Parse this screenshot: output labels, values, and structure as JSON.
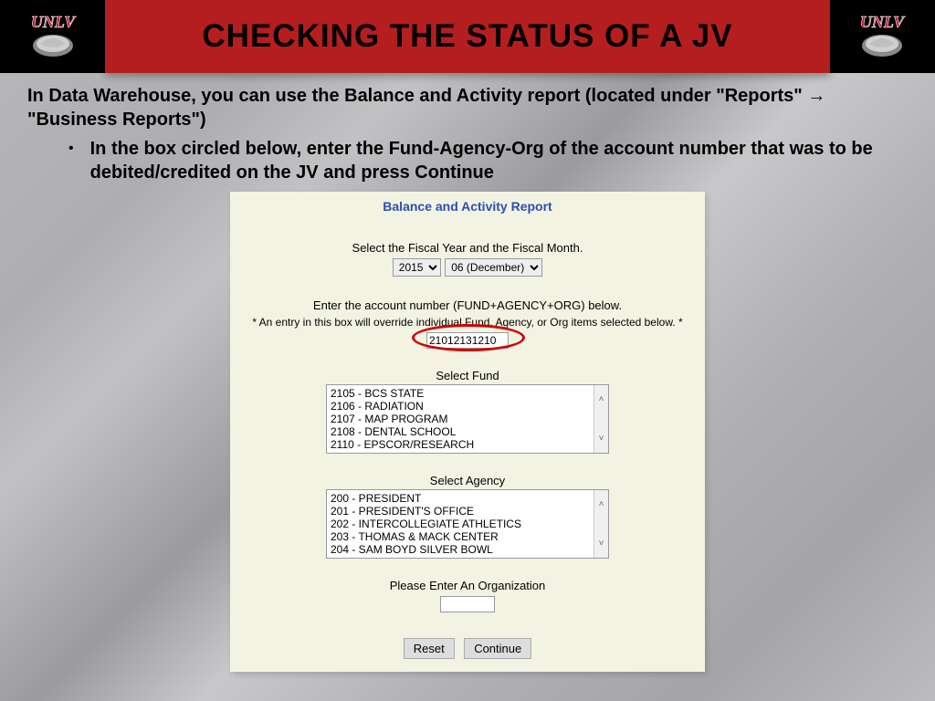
{
  "header": {
    "title": "CHECKING THE STATUS OF A JV"
  },
  "intro": {
    "line1_pre": "In Data Warehouse, you can use the Balance and Activity report (located under \"Reports\" ",
    "arrow": "→",
    "line1_post": " \"Business Reports\")"
  },
  "bullet": {
    "text": "In the box circled below, enter the Fund-Agency-Org of the account number that was to be debited/credited on the JV and press Continue"
  },
  "report": {
    "title": "Balance and Activity Report",
    "select_fy_line": "Select the Fiscal Year and the Fiscal Month.",
    "year_selected": "2015",
    "month_selected": "06  (December)",
    "acct_line": "Enter the account number (FUND+AGENCY+ORG) below.",
    "acct_hint": "* An entry in this box will override individual Fund, Agency, or Org items selected below. *",
    "acct_value": "21012131210",
    "fund_label": "Select Fund",
    "fund_items": [
      "2105 - BCS STATE",
      "2106 - RADIATION",
      "2107 - MAP PROGRAM",
      "2108 - DENTAL SCHOOL",
      "2110 - EPSCOR/RESEARCH"
    ],
    "agency_label": "Select Agency",
    "agency_items": [
      "200 - PRESIDENT",
      "201 - PRESIDENT'S OFFICE",
      "202 - INTERCOLLEGIATE ATHLETICS",
      "203 - THOMAS & MACK CENTER",
      "204 - SAM BOYD SILVER BOWL"
    ],
    "org_label": "Please Enter An Organization",
    "org_value": "",
    "reset_label": "Reset",
    "continue_label": "Continue"
  }
}
